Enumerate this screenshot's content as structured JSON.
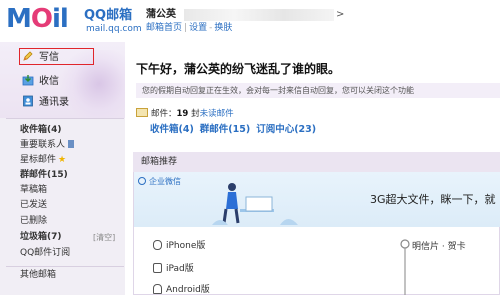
{
  "header": {
    "logo_text": "MOil",
    "logo_cn": "QQ邮箱",
    "logo_domain": "mail.qq.com",
    "user_name": "蒲公英",
    "user_email_end": ">",
    "links": [
      "邮箱首页",
      "设置",
      "换肤"
    ]
  },
  "sidebar": {
    "write": "写信",
    "inbox": "收信",
    "contacts": "通讯录",
    "folders": [
      {
        "label": "收件箱",
        "count": "(4)"
      },
      {
        "label": "重要联系人",
        "count": ""
      },
      {
        "label": "星标邮件",
        "count": ""
      },
      {
        "label": "群邮件",
        "count": "(15)"
      },
      {
        "label": "草稿箱",
        "count": ""
      },
      {
        "label": "已发送",
        "count": ""
      },
      {
        "label": "已删除",
        "count": ""
      },
      {
        "label": "垃圾箱",
        "count": "(7)"
      },
      {
        "label": "QQ邮件订阅",
        "count": ""
      },
      {
        "label": "其他邮箱",
        "count": ""
      }
    ],
    "clear_label": "[清空]"
  },
  "main": {
    "greeting": "下午好，蒲公英的纷飞迷乱了谁的眼。",
    "notice": "您的假期自动回复正在生效，会对每一封来信自动回复，您可以关闭这个功能",
    "mail_label": "邮件：",
    "mail_count": "19",
    "mail_unit": "封",
    "unread_label": "未读邮件",
    "quick_links": [
      "收件箱(4)",
      "群邮件(15)",
      "订阅中心(23)"
    ],
    "recommend_title": "邮箱推荐",
    "banner_brand": "企业微信",
    "banner_text": "3G超大文件，眯一下，就",
    "banner_right": "就",
    "downloads": [
      "iPhone版",
      "iPad版",
      "Android版"
    ],
    "postcard": "明信片 · 贺卡"
  },
  "colors": {
    "brand_blue": "#2b6fc2",
    "brand_pink": "#e53b77",
    "sidebar_bg": "#f1eef5",
    "highlight_red": "#e0252b"
  }
}
